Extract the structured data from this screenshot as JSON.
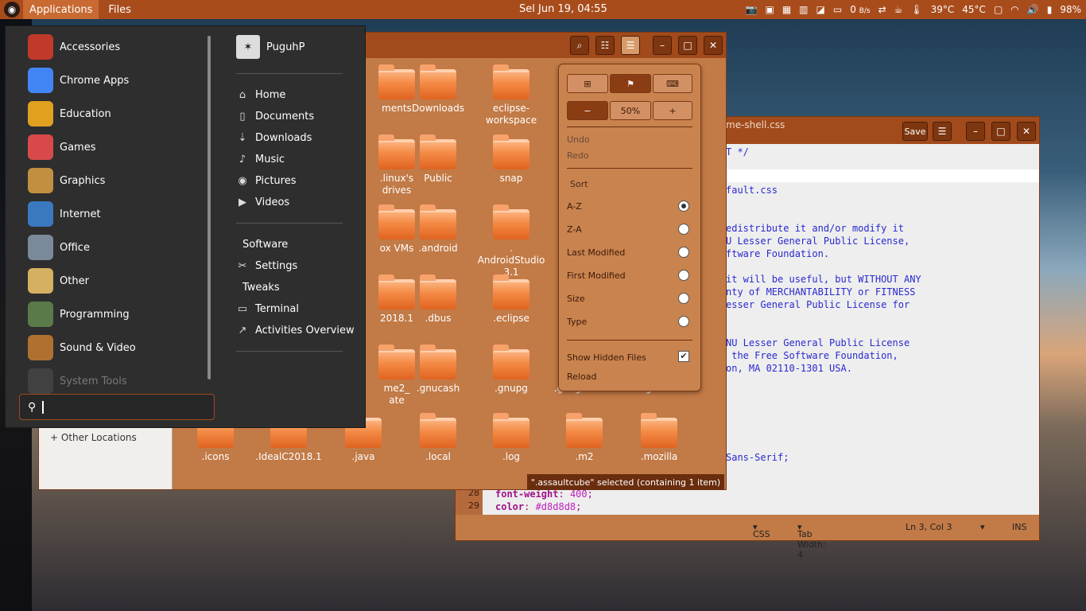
{
  "topbar": {
    "applications": "Applications",
    "files": "Files",
    "clock": "Sel Jun 19, 04:55",
    "net_speed": "0",
    "net_unit": "B/s",
    "temp1": "39°C",
    "temp2": "45°C",
    "battery": "98%"
  },
  "file_manager": {
    "folders": [
      {
        "label": "ments"
      },
      {
        "label": "Downloads"
      },
      {
        "label": "eclipse-\nworkspace"
      },
      {
        "label": ".linux's\ndrives"
      },
      {
        "label": "Public"
      },
      {
        "label": "snap"
      },
      {
        "label": "ox VMs"
      },
      {
        "label": ".android"
      },
      {
        "label": ".\nAndroidStudio\n3.1"
      },
      {
        "label": "2018.1"
      },
      {
        "label": ".dbus"
      },
      {
        "label": ".eclipse"
      },
      {
        "label": "me2_\nate"
      },
      {
        "label": ".gnucash"
      },
      {
        "label": ".gnupg"
      },
      {
        "label": ".googleearth"
      },
      {
        "label": ".gradle"
      },
      {
        "label": ".icons"
      },
      {
        "label": ".IdealC2018.1"
      },
      {
        "label": ".java"
      },
      {
        "label": ".local"
      },
      {
        "label": ".log"
      },
      {
        "label": ".m2"
      },
      {
        "label": ".mozilla"
      }
    ],
    "sidebar_other": "Other Locations",
    "status": "\".assaultcube\" selected  (containing 1 item)"
  },
  "popover": {
    "zoom": "50%",
    "undo": "Undo",
    "redo": "Redo",
    "sort": "Sort",
    "sort_options": [
      "A-Z",
      "Z-A",
      "Last Modified",
      "First Modified",
      "Size",
      "Type"
    ],
    "sort_selected": "A-Z",
    "show_hidden": "Show Hidden Files",
    "show_hidden_checked": true,
    "reload": "Reload"
  },
  "editor": {
    "title": "me-shell.css",
    "save": "Save",
    "code_lines": [
      "T */",
      "",
      "",
      "fault.css",
      "",
      "",
      "edistribute it and/or modify it",
      "U Lesser General Public License,",
      "ftware Foundation.",
      "",
      "it will be useful, but WITHOUT ANY",
      "nty of MERCHANTABILITY or FITNESS",
      "esser General Public License for",
      "",
      "",
      "NU Lesser General Public License",
      " the Free Software Foundation,",
      "on, MA 02110-1301 USA.",
      "",
      "",
      "",
      "",
      "",
      "",
      "Sans-Serif;"
    ],
    "line_numbers": [
      "28",
      "29"
    ],
    "code_prop1": "font-weight",
    "code_val1": "400",
    "code_prop2": "color",
    "code_val2": "#d8d8d8",
    "lang": "CSS",
    "tab_width": "Tab Width: 4",
    "position": "Ln 3, Col 3",
    "mode": "INS"
  },
  "menu": {
    "categories": [
      "Accessories",
      "Chrome Apps",
      "Education",
      "Games",
      "Graphics",
      "Internet",
      "Office",
      "Other",
      "Programming",
      "Sound & Video",
      "System Tools"
    ],
    "user": "PuguhP",
    "places": [
      "Home",
      "Documents",
      "Downloads",
      "Music",
      "Pictures",
      "Videos"
    ],
    "apps": [
      "Software",
      "Settings",
      "Tweaks",
      "Terminal",
      "Activities Overview"
    ],
    "colors": {
      "accent": "#a94c1c",
      "folder": "#f48a45",
      "menu_bg": "#2e2e2e"
    }
  }
}
